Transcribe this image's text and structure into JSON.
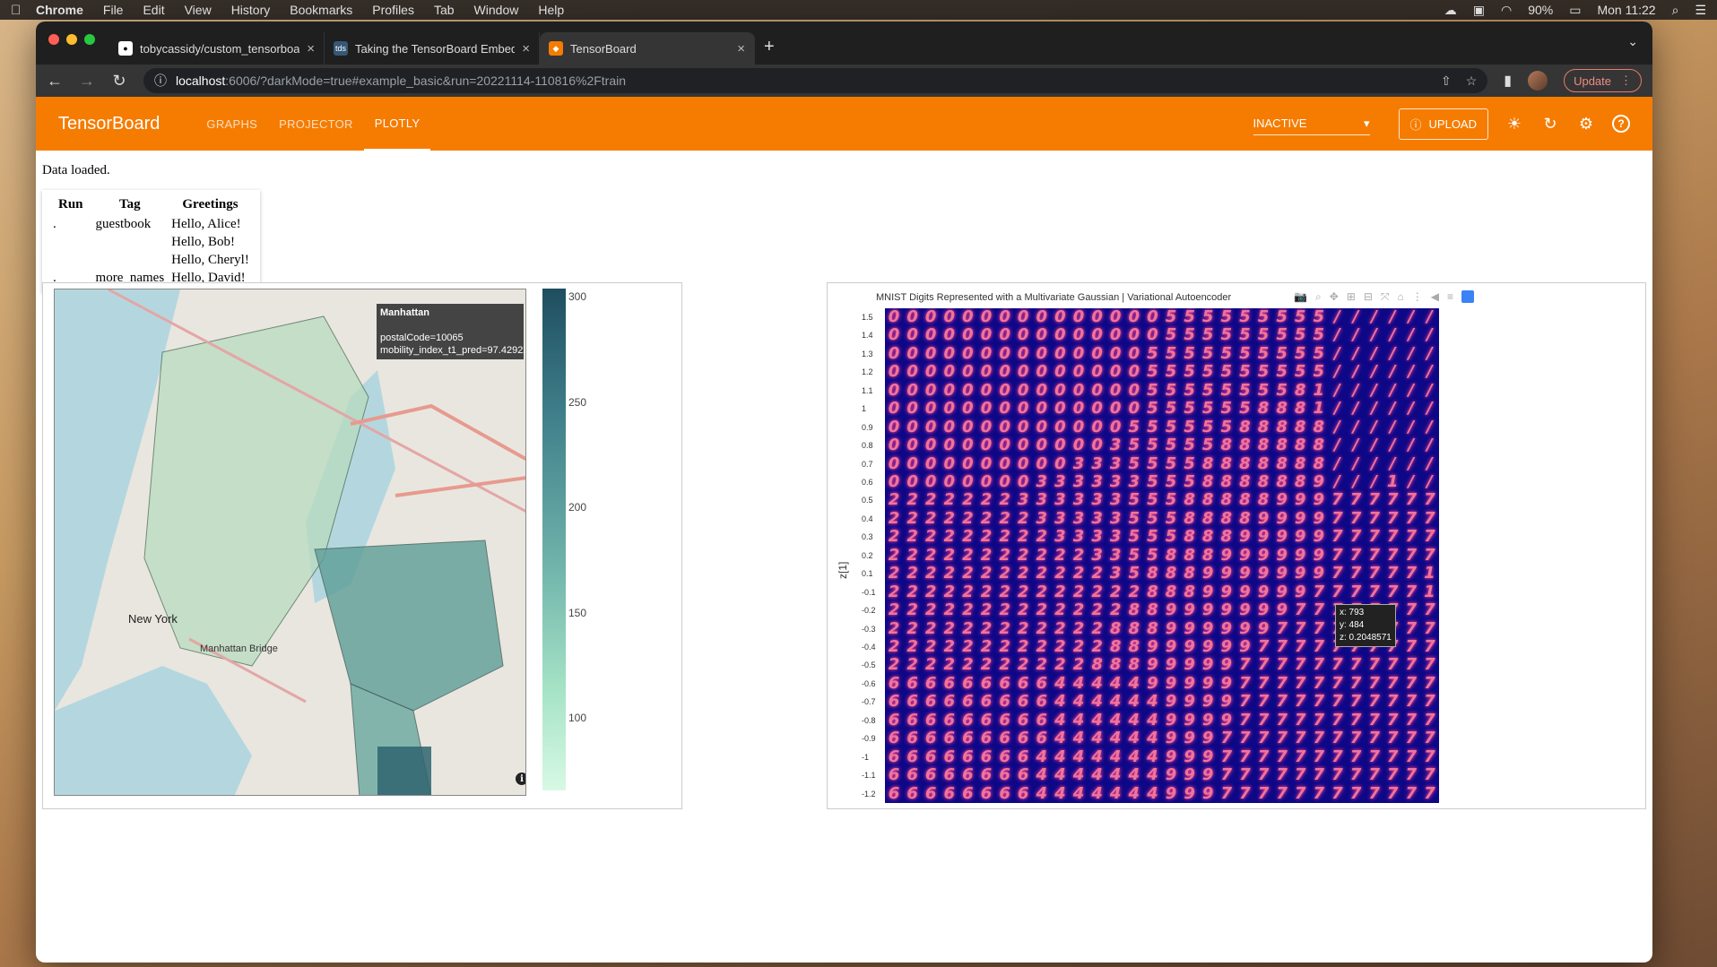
{
  "menubar": {
    "app": "Chrome",
    "items": [
      "File",
      "Edit",
      "View",
      "History",
      "Bookmarks",
      "Profiles",
      "Tab",
      "Window",
      "Help"
    ],
    "battery": "90%",
    "clock": "Mon 11:22"
  },
  "browser": {
    "tabs": [
      {
        "label": "tobycassidy/custom_tensorboard",
        "favicon": "github-icon"
      },
      {
        "label": "Taking the TensorBoard Embed",
        "favicon": "tds-icon"
      },
      {
        "label": "TensorBoard",
        "favicon": "tensorboard-icon"
      }
    ],
    "url_host": "localhost",
    "url_path": ":6006/?darkMode=true#example_basic&run=20221114-110816%2Ftrain",
    "update_label": "Update"
  },
  "tensorboard": {
    "title": "TensorBoard",
    "nav": [
      "GRAPHS",
      "PROJECTOR",
      "PLOTLY"
    ],
    "active_nav": "PLOTLY",
    "run_select": "INACTIVE",
    "upload_label": "UPLOAD"
  },
  "content": {
    "status": "Data loaded.",
    "table": {
      "headers": [
        "Run",
        "Tag",
        "Greetings"
      ],
      "rows": [
        [
          ".",
          "guestbook",
          "Hello, Alice!"
        ],
        [
          "",
          "",
          "Hello, Bob!"
        ],
        [
          "",
          "",
          "Hello, Cheryl!"
        ],
        [
          ".",
          "more_names",
          "Hello, David!"
        ]
      ]
    }
  },
  "map": {
    "colorbar_ticks": [
      "300",
      "250",
      "200",
      "150",
      "100"
    ],
    "hover": {
      "name": "Manhattan",
      "line1": "postalCode=10065",
      "line2": "mobility_index_t1_pred=97.42922"
    },
    "place_labels": [
      "New York",
      "Manhattan Bridge"
    ]
  },
  "vae": {
    "title": "MNIST Digits Represented with a Multivariate Gaussian | Variational Autoencoder",
    "ylabel": "z[1]",
    "yticks": [
      "1.5",
      "1.4",
      "1.3",
      "1.2",
      "1.1",
      "1",
      "0.9",
      "0.8",
      "0.7",
      "0.6",
      "0.5",
      "0.4",
      "0.3",
      "0.2",
      "0.1",
      "-0.1",
      "-0.2",
      "-0.3",
      "-0.4",
      "-0.5",
      "-0.6",
      "-0.7",
      "-0.8",
      "-0.9",
      "-1",
      "-1.1",
      "-1.2"
    ],
    "digit_rows": [
      "000000000000000555555555//////",
      "000000000000000555555555//////",
      "000000000000005555555555//////",
      "000000000000005555555555//////",
      "000000000000005555555581//////",
      "000000000000005555558881//////",
      "000000000000055555588888//////",
      "000000000000355555888888//////",
      "000000000033355558888888//////",
      "000000003333335558888889///1//",
      "222222233333355588888999777777",
      "222222223333355588889999777777",
      "222222222333355588899999777777",
      "222222222223355888999999777777",
      "222222222222358889999999777771",
      "222222222222228889999997777771",
      "222222222222288999999977777777",
      "222222222222888999999777777777",
      "222222222222889999997777777777",
      "222222222228889999977777777777",
      "666666666444449999977777777777",
      "666666666444444999977777777777",
      "666666666444444999977777777777",
      "666666666444444999777777777777",
      "666666664444444999777777777777",
      "666666664444444999777777777777",
      "666666664444444999777777777777"
    ],
    "hover": {
      "x": "x: 793",
      "y": "y: 484",
      "z": "z: 0.2048571"
    }
  }
}
